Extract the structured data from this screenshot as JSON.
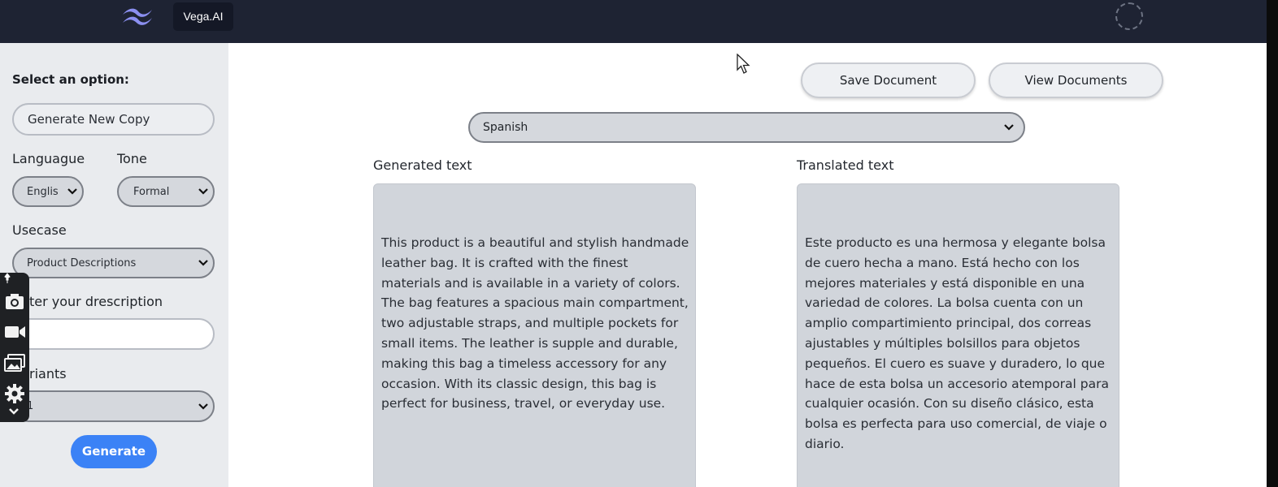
{
  "header": {
    "brand": "Vega.AI",
    "logo_icon": "wind-logo-icon",
    "avatar_icon": "avatar-icon"
  },
  "sidebar": {
    "select_label": "Select an option:",
    "option_value": "Generate New Copy",
    "language_label": "Languague",
    "language_value": "Englis",
    "tone_label": "Tone",
    "tone_value": "Formal",
    "usecase_label": "Usecase",
    "usecase_value": "Product Descriptions",
    "description_label": "ter your drescription",
    "description_value": "",
    "variants_label": "riants",
    "variants_value": "1",
    "generate_label": "Generate"
  },
  "floating_toolbar": {
    "icons": [
      "pin-icon",
      "camera-icon",
      "video-icon",
      "gallery-icon",
      "gear-icon",
      "chevron-down-icon"
    ]
  },
  "main": {
    "save_label": "Save Document",
    "view_label": "View Documents",
    "translation_language": "Spanish",
    "generated_title": "Generated text",
    "translated_title": "Translated text",
    "generated_text": "This product is a beautiful and stylish handmade leather bag. It is crafted with the finest materials and is available in a variety of colors. The bag features a spacious main compartment, two adjustable straps, and multiple pockets for small items. The leather is supple and durable, making this bag a timeless accessory for any occasion. With its classic design, this bag is perfect for business, travel, or everyday use.",
    "translated_text": "Este producto es una hermosa y elegante bolsa de cuero hecha a mano. Está hecho con los mejores materiales y está disponible en una variedad de colores. La bolsa cuenta con un amplio compartimiento principal, dos correas ajustables y múltiples bolsillos para objetos pequeños. El cuero es suave y duradero, lo que hace de esta bolsa un accesorio atemporal para cualquier ocasión. Con su diseño clásico, esta bolsa es perfecta para uso comercial, de viaje o diario."
  },
  "colors": {
    "header_bg": "#1e2333",
    "accent": "#3b82f6",
    "sidebar_bg": "#e9ebee",
    "textbox_bg": "#d1d5db"
  }
}
